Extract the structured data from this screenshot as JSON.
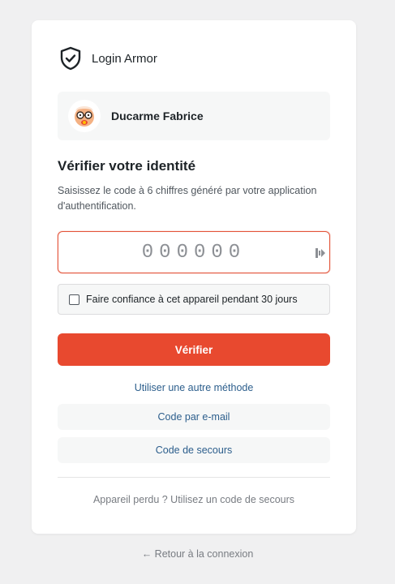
{
  "brand": {
    "name": "Login Armor",
    "icon": "shield-check-icon"
  },
  "user": {
    "name": "Ducarme Fabrice",
    "avatar_icon": "avatar-cartoon-glasses"
  },
  "verify": {
    "title": "Vérifier votre identité",
    "description": "Saisissez le code à 6 chiffres généré par votre application d'authentification.",
    "code_placeholder": "000000",
    "code_value": ""
  },
  "trust": {
    "label": "Faire confiance à cet appareil pendant 30 jours",
    "checked": false
  },
  "actions": {
    "verify_label": "Vérifier",
    "other_method_label": "Utiliser une autre méthode",
    "email_code_label": "Code par e-mail",
    "backup_code_label": "Code de secours",
    "lost_device_label": "Appareil perdu ? Utilisez un code de secours",
    "back_label": "← Retour à la connexion"
  },
  "colors": {
    "accent": "#e8492f",
    "link": "#2c5e8c",
    "background": "#f0f0f1"
  }
}
